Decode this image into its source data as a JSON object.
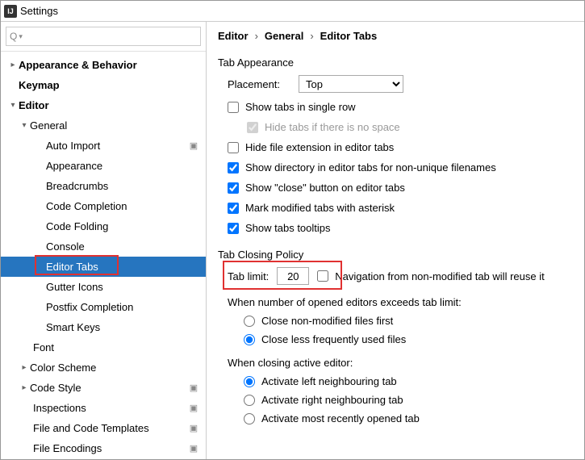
{
  "titlebar": {
    "title": "Settings"
  },
  "search": {
    "placeholder": ""
  },
  "tree": {
    "appearance_behavior": "Appearance & Behavior",
    "keymap": "Keymap",
    "editor": "Editor",
    "general": "General",
    "auto_import": "Auto Import",
    "appearance": "Appearance",
    "breadcrumbs": "Breadcrumbs",
    "code_completion": "Code Completion",
    "code_folding": "Code Folding",
    "console": "Console",
    "editor_tabs": "Editor Tabs",
    "gutter_icons": "Gutter Icons",
    "postfix_completion": "Postfix Completion",
    "smart_keys": "Smart Keys",
    "font": "Font",
    "color_scheme": "Color Scheme",
    "code_style": "Code Style",
    "inspections": "Inspections",
    "file_code_templates": "File and Code Templates",
    "file_encodings": "File Encodings"
  },
  "breadcrumb": {
    "a": "Editor",
    "b": "General",
    "c": "Editor Tabs"
  },
  "section1": {
    "title": "Tab Appearance",
    "placement_label": "Placement:",
    "placement_value": "Top",
    "show_single_row": "Show tabs in single row",
    "hide_no_space": "Hide tabs if there is no space",
    "hide_ext": "Hide file extension in editor tabs",
    "show_dir": "Show directory in editor tabs for non-unique filenames",
    "show_close": "Show \"close\" button on editor tabs",
    "mark_modified": "Mark modified tabs with asterisk",
    "show_tooltips": "Show tabs tooltips"
  },
  "section2": {
    "title": "Tab Closing Policy",
    "tab_limit_label": "Tab limit:",
    "tab_limit_value": "20",
    "nav_reuse": "Navigation from non-modified tab will reuse it",
    "exceed_label": "When number of opened editors exceeds tab limit:",
    "close_nonmod": "Close non-modified files first",
    "close_lfu": "Close less frequently used files",
    "closing_label": "When closing active editor:",
    "activate_left": "Activate left neighbouring tab",
    "activate_right": "Activate right neighbouring tab",
    "activate_recent": "Activate most recently opened tab"
  }
}
